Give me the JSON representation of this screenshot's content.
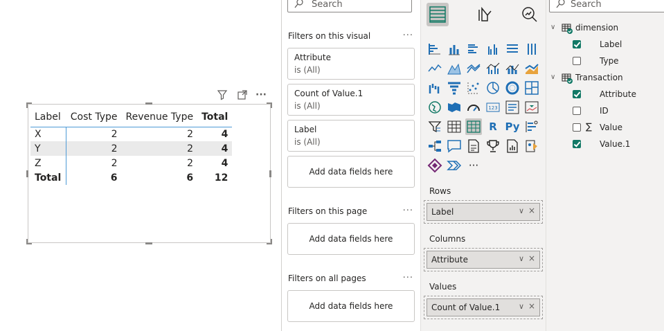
{
  "visual": {
    "header_icons": [
      "filter-icon",
      "focus-mode-icon",
      "more-options-icon"
    ],
    "more_glyph": "···",
    "matrix": {
      "columns": [
        "Label",
        "Cost Type",
        "Revenue Type",
        "Total"
      ],
      "rows": [
        {
          "label": "X",
          "cost": "2",
          "revenue": "2",
          "total": "4"
        },
        {
          "label": "Y",
          "cost": "2",
          "revenue": "2",
          "total": "4"
        },
        {
          "label": "Z",
          "cost": "2",
          "revenue": "2",
          "total": "4"
        }
      ],
      "total_row": {
        "label": "Total",
        "cost": "6",
        "revenue": "6",
        "total": "12"
      },
      "highlighted_row": "Y"
    }
  },
  "filters": {
    "search_placeholder": "Search",
    "on_visual": {
      "title": "Filters on this visual",
      "cards": [
        {
          "field": "Attribute",
          "state": "is (All)"
        },
        {
          "field": "Count of Value.1",
          "state": "is (All)"
        },
        {
          "field": "Label",
          "state": "is (All)"
        }
      ],
      "add_label": "Add data fields here"
    },
    "on_page": {
      "title": "Filters on this page",
      "add_label": "Add data fields here"
    },
    "on_all_pages": {
      "title": "Filters on all pages",
      "add_label": "Add data fields here"
    },
    "more_glyph": "···"
  },
  "visualizations": {
    "tabs": [
      "build-visual-icon",
      "format-visual-icon",
      "analytics-icon"
    ],
    "text_icons": {
      "r": "R",
      "py": "Py",
      "more": "···"
    },
    "wells": {
      "rows": {
        "title": "Rows",
        "field": "Label"
      },
      "columns": {
        "title": "Columns",
        "field": "Attribute"
      },
      "values": {
        "title": "Values",
        "field": "Count of Value.1"
      }
    },
    "pill_chevron": "∨",
    "pill_remove": "×"
  },
  "fields": {
    "search_placeholder": "Search",
    "tables": [
      {
        "name": "dimension",
        "fields": [
          {
            "name": "Label",
            "checked": true,
            "sigma": false
          },
          {
            "name": "Type",
            "checked": false,
            "sigma": false
          }
        ]
      },
      {
        "name": "Transaction",
        "fields": [
          {
            "name": "Attribute",
            "checked": true,
            "sigma": false
          },
          {
            "name": "ID",
            "checked": false,
            "sigma": false
          },
          {
            "name": "Value",
            "checked": false,
            "sigma": true
          },
          {
            "name": "Value.1",
            "checked": true,
            "sigma": false
          }
        ]
      }
    ],
    "sigma_glyph": "∑",
    "expand_glyph": "∨"
  },
  "colors": {
    "accent_blue": "#4d9ad6",
    "check_green": "#117865",
    "pane_bg": "#f3f2f1"
  }
}
